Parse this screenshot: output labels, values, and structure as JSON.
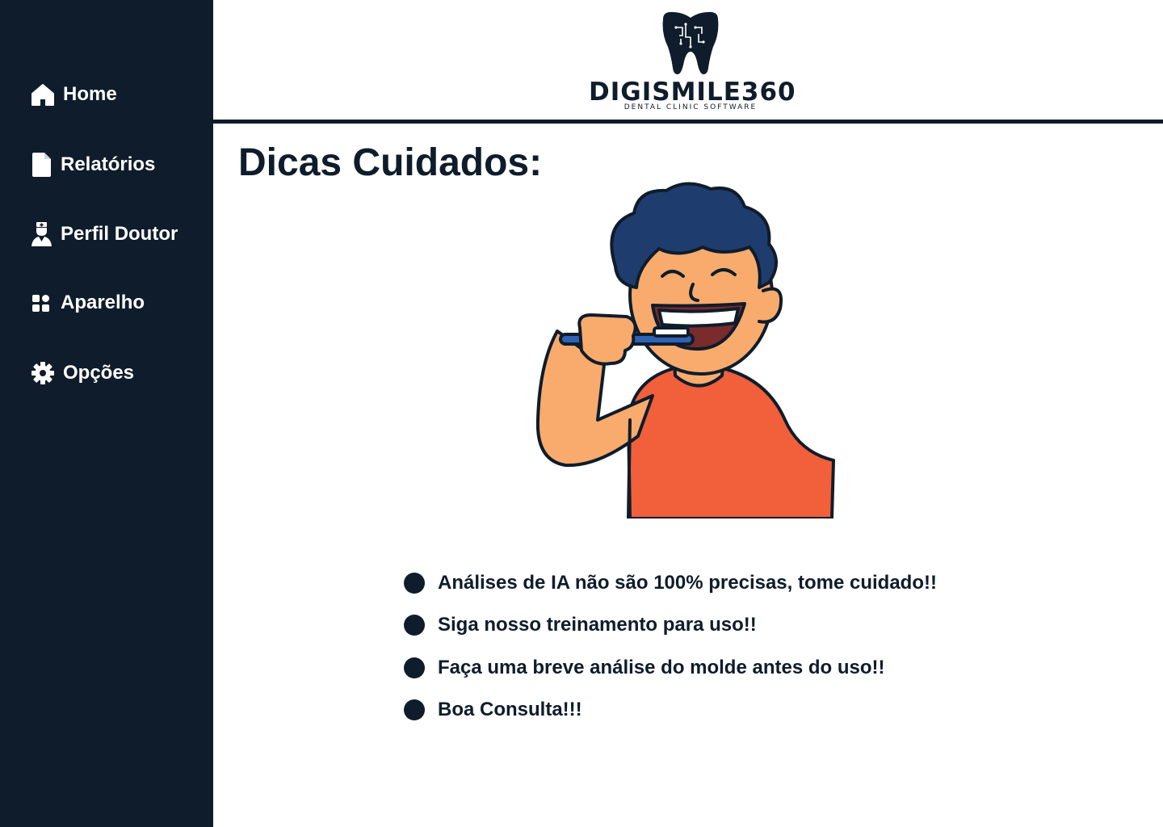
{
  "sidebar": {
    "items": [
      {
        "label": "Home",
        "icon": "home-icon"
      },
      {
        "label": "Relatórios",
        "icon": "document-icon"
      },
      {
        "label": "Perfil Doutor",
        "icon": "doctor-icon"
      },
      {
        "label": "Aparelho",
        "icon": "grid-icon"
      },
      {
        "label": "Opções",
        "icon": "gear-icon"
      }
    ]
  },
  "header": {
    "logo_text": "DIGISMILE360",
    "logo_subtext": "DENTAL CLINIC SOFTWARE"
  },
  "main": {
    "title": "Dicas Cuidados:",
    "tips": [
      "Análises de IA não são 100% precisas, tome cuidado!!",
      "Siga nosso treinamento para uso!!",
      "Faça uma breve análise do molde antes do uso!!",
      "Boa Consulta!!!"
    ]
  },
  "colors": {
    "sidebar_bg": "#0f1c2b",
    "text": "#0f1c2b",
    "shirt": "#f15f3b",
    "hair": "#1e3d6e",
    "skin": "#f8ab6d"
  }
}
